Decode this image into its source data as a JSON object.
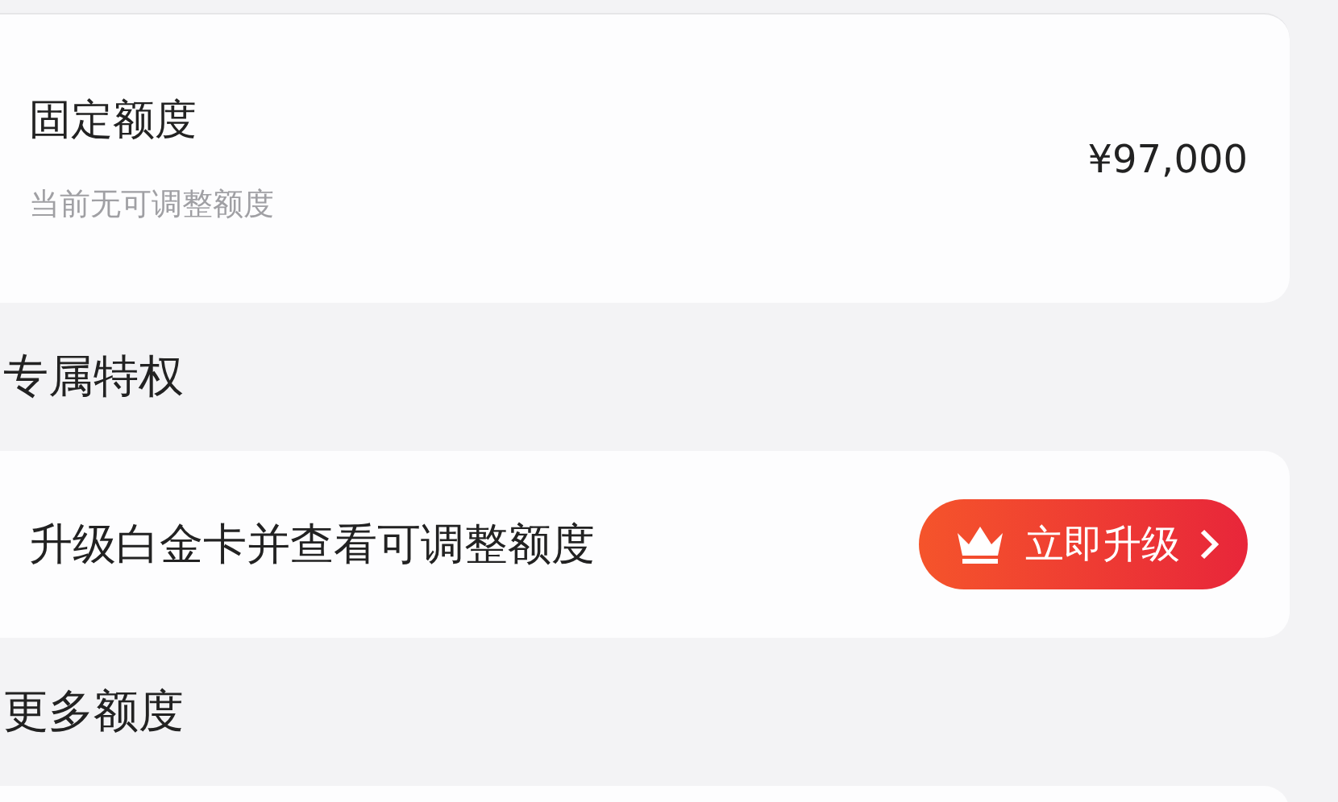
{
  "limit_card": {
    "title": "固定额度",
    "subtitle": "当前无可调整额度",
    "amount": "¥97,000"
  },
  "privilege_section": {
    "heading": "专属特权",
    "text": "升级白金卡并查看可调整额度",
    "button": "立即升级"
  },
  "more_section": {
    "heading": "更多额度"
  }
}
